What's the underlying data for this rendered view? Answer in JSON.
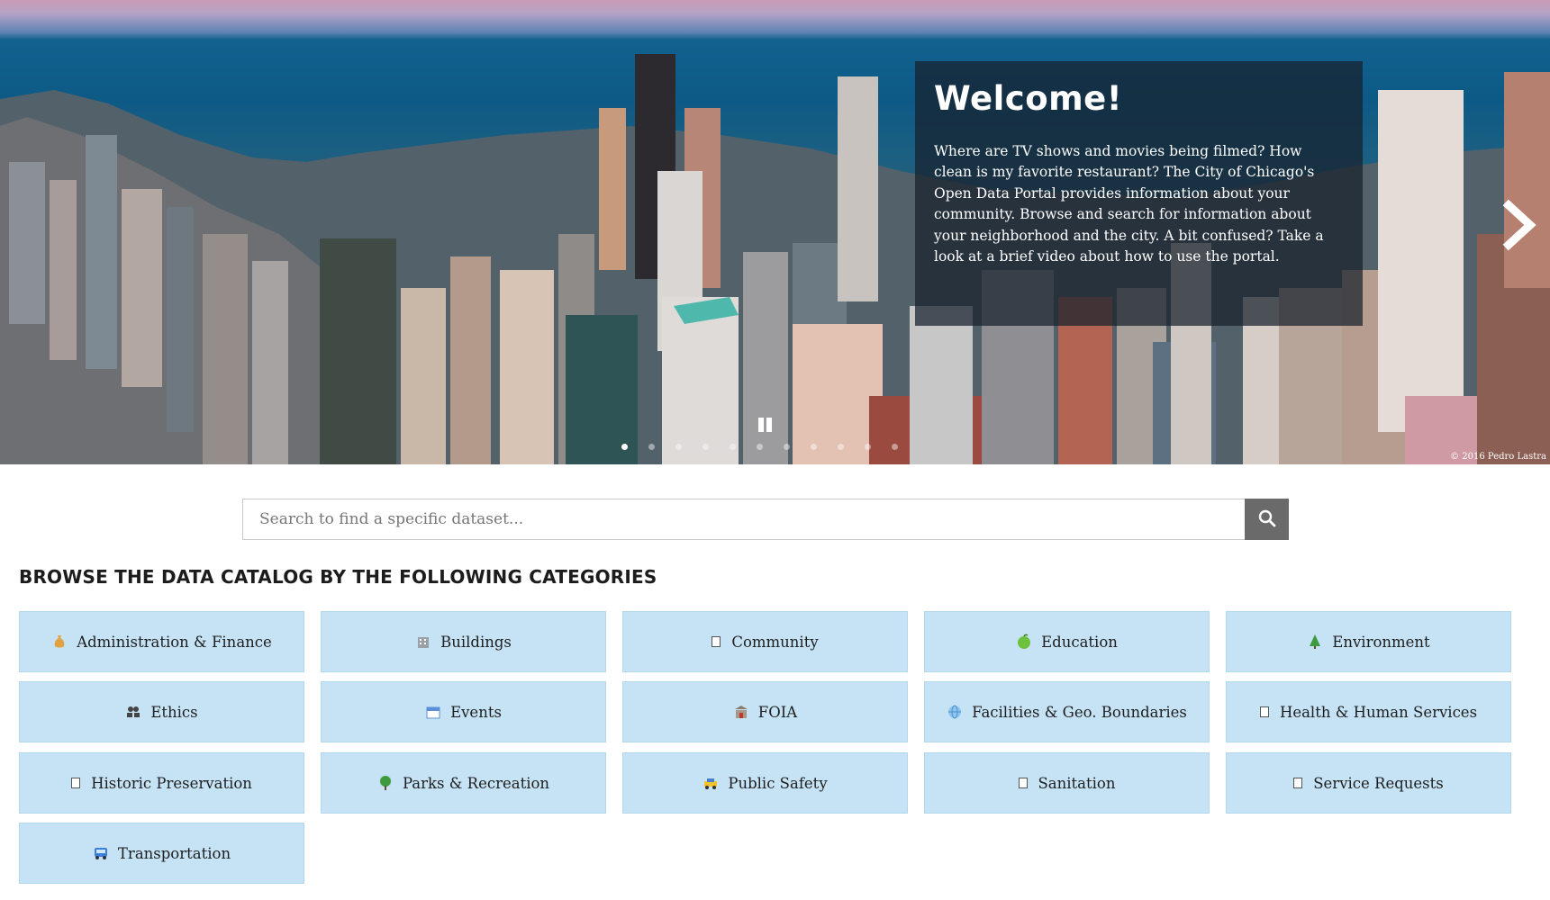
{
  "hero": {
    "welcome_title": "Welcome!",
    "welcome_text": "Where are TV shows and movies being filmed? How clean is my favorite restaurant? The City of Chicago's Open Data Portal provides information about your community. Browse and search for information about your neighborhood and the city. A bit confused? Take a look at a brief video about how to use the portal.",
    "credit": "© 2016 Pedro Lastra",
    "next_icon": "chevron-right-icon",
    "pause_icon": "pause-icon",
    "slide_count": 11,
    "active_slide": 1
  },
  "search": {
    "placeholder": "Search to find a specific dataset...",
    "value": "",
    "button_icon": "search-icon"
  },
  "browse": {
    "title": "BROWSE THE DATA CATALOG BY THE FOLLOWING CATEGORIES",
    "categories": [
      {
        "label": "Administration & Finance",
        "icon": "money-bag-icon"
      },
      {
        "label": "Buildings",
        "icon": "building-icon"
      },
      {
        "label": "Community",
        "icon": "missing-image-icon"
      },
      {
        "label": "Education",
        "icon": "apple-icon"
      },
      {
        "label": "Environment",
        "icon": "tree-icon"
      },
      {
        "label": "Ethics",
        "icon": "people-icon"
      },
      {
        "label": "Events",
        "icon": "calendar-icon"
      },
      {
        "label": "FOIA",
        "icon": "government-building-icon"
      },
      {
        "label": "Facilities & Geo. Boundaries",
        "icon": "globe-icon"
      },
      {
        "label": "Health & Human Services",
        "icon": "missing-image-icon"
      },
      {
        "label": "Historic Preservation",
        "icon": "missing-image-icon"
      },
      {
        "label": "Parks & Recreation",
        "icon": "tree-icon"
      },
      {
        "label": "Public Safety",
        "icon": "police-car-icon"
      },
      {
        "label": "Sanitation",
        "icon": "missing-image-icon"
      },
      {
        "label": "Service Requests",
        "icon": "missing-image-icon"
      },
      {
        "label": "Transportation",
        "icon": "bus-icon"
      }
    ]
  },
  "colors": {
    "tile_bg": "#c5e3f5",
    "search_button": "#6a6a6a",
    "welcome_overlay": "rgba(22,32,44,0.72)"
  }
}
